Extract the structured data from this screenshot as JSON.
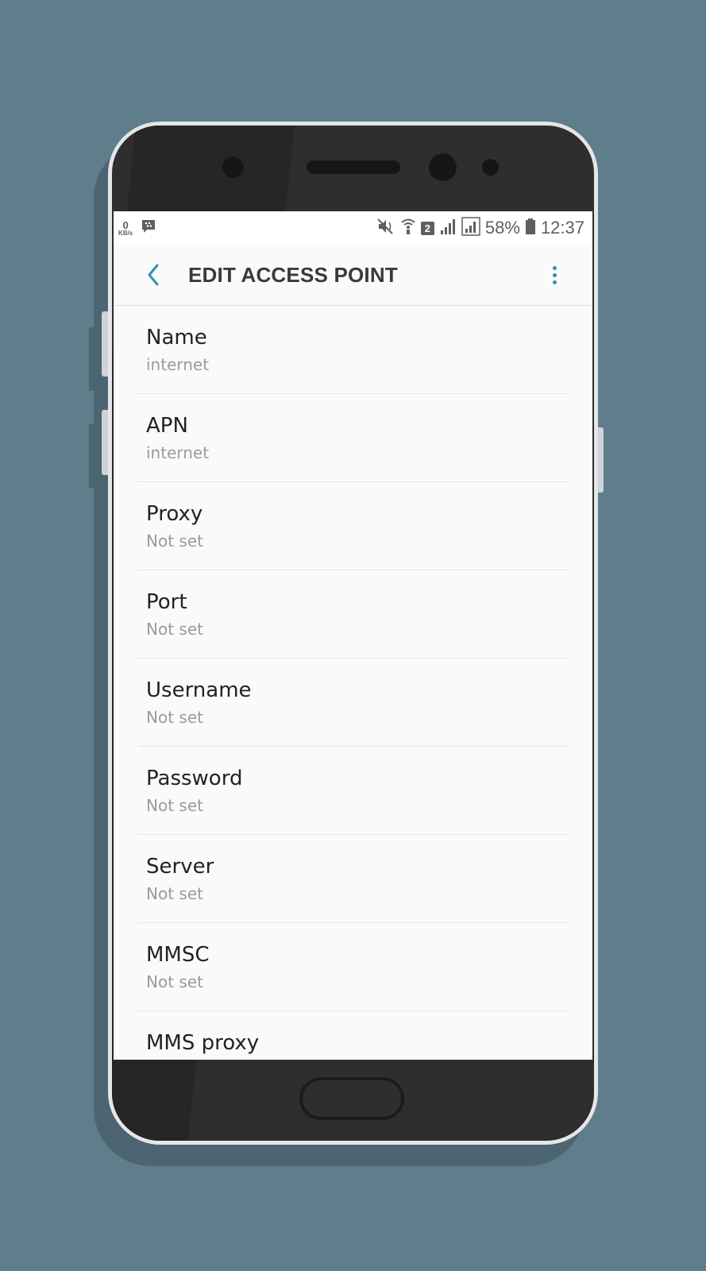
{
  "status_bar": {
    "data_speed_value": "0",
    "data_speed_unit": "KB/s",
    "sim_slot": "2",
    "battery_percent": "58%",
    "time": "12:37",
    "icons": [
      "bbm-icon",
      "mute-icon",
      "wifi-calling-icon",
      "signal-icon",
      "battery-icon"
    ]
  },
  "app_bar": {
    "title": "EDIT ACCESS POINT",
    "accent_color": "#2f93b4"
  },
  "settings": [
    {
      "label": "Name",
      "value": "internet"
    },
    {
      "label": "APN",
      "value": "internet"
    },
    {
      "label": "Proxy",
      "value": "Not set"
    },
    {
      "label": "Port",
      "value": "Not set"
    },
    {
      "label": "Username",
      "value": "Not set"
    },
    {
      "label": "Password",
      "value": "Not set"
    },
    {
      "label": "Server",
      "value": "Not set"
    },
    {
      "label": "MMSC",
      "value": "Not set"
    },
    {
      "label": "MMS proxy",
      "value": ""
    }
  ]
}
